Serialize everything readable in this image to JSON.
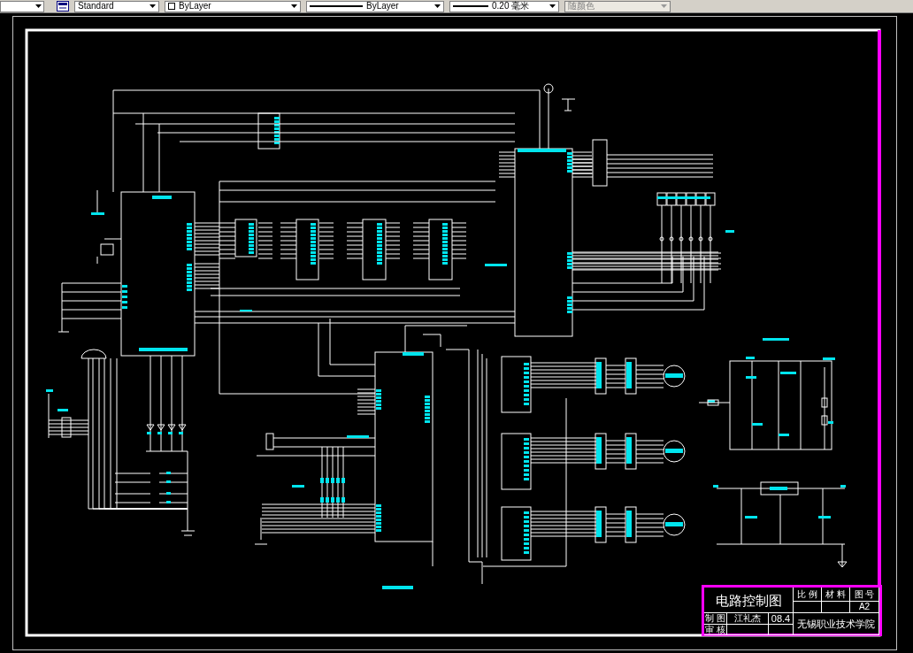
{
  "toolbar": {
    "items": [
      {
        "kind": "style",
        "text": "Standard"
      },
      {
        "kind": "layer",
        "text": "ByLayer"
      },
      {
        "kind": "linetype",
        "text": "ByLayer"
      },
      {
        "kind": "lineweight",
        "text": "0.20 毫米"
      },
      {
        "kind": "color",
        "text": "随颜色"
      }
    ]
  },
  "title_block": {
    "title": "电路控制图",
    "headers": [
      "比 例",
      "材 料",
      "图 号"
    ],
    "drawing_number": "A2",
    "drafted_label": "制 图",
    "drafter": "江礼杰",
    "date": "08.4",
    "reviewed_label": "审 核",
    "school": "无锡职业技术学院"
  }
}
